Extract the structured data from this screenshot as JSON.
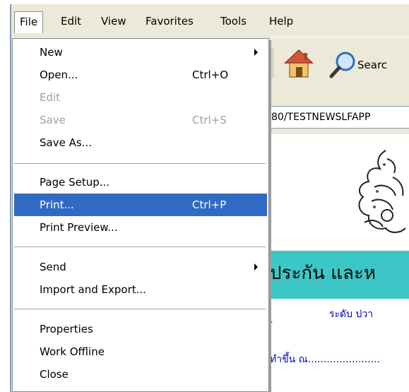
{
  "menubar": {
    "items": [
      "File",
      "Edit",
      "View",
      "Favorites",
      "Tools",
      "Help"
    ]
  },
  "file_menu": {
    "new": "New",
    "open": "Open...",
    "open_shortcut": "Ctrl+O",
    "edit": "Edit",
    "save": "Save",
    "save_shortcut": "Ctrl+S",
    "save_as": "Save As...",
    "page_setup": "Page Setup...",
    "print": "Print...",
    "print_shortcut": "Ctrl+P",
    "print_preview": "Print Preview...",
    "send": "Send",
    "import_export": "Import and Export...",
    "properties": "Properties",
    "work_offline": "Work Offline",
    "close": "Close"
  },
  "toolbar": {
    "search_label": "Searc"
  },
  "address": {
    "url": "80/TESTNEWSLFAPP"
  },
  "page": {
    "banner_text": "ประกัน และห",
    "line1": "ระดับ ปวา",
    "line2": "ทำขึ้น ณ.......................",
    "dash": "-"
  },
  "colors": {
    "menu_highlight": "#316ac5",
    "chrome": "#ece9d8",
    "banner": "#3cc7c6",
    "link_blue": "#0000cc"
  }
}
